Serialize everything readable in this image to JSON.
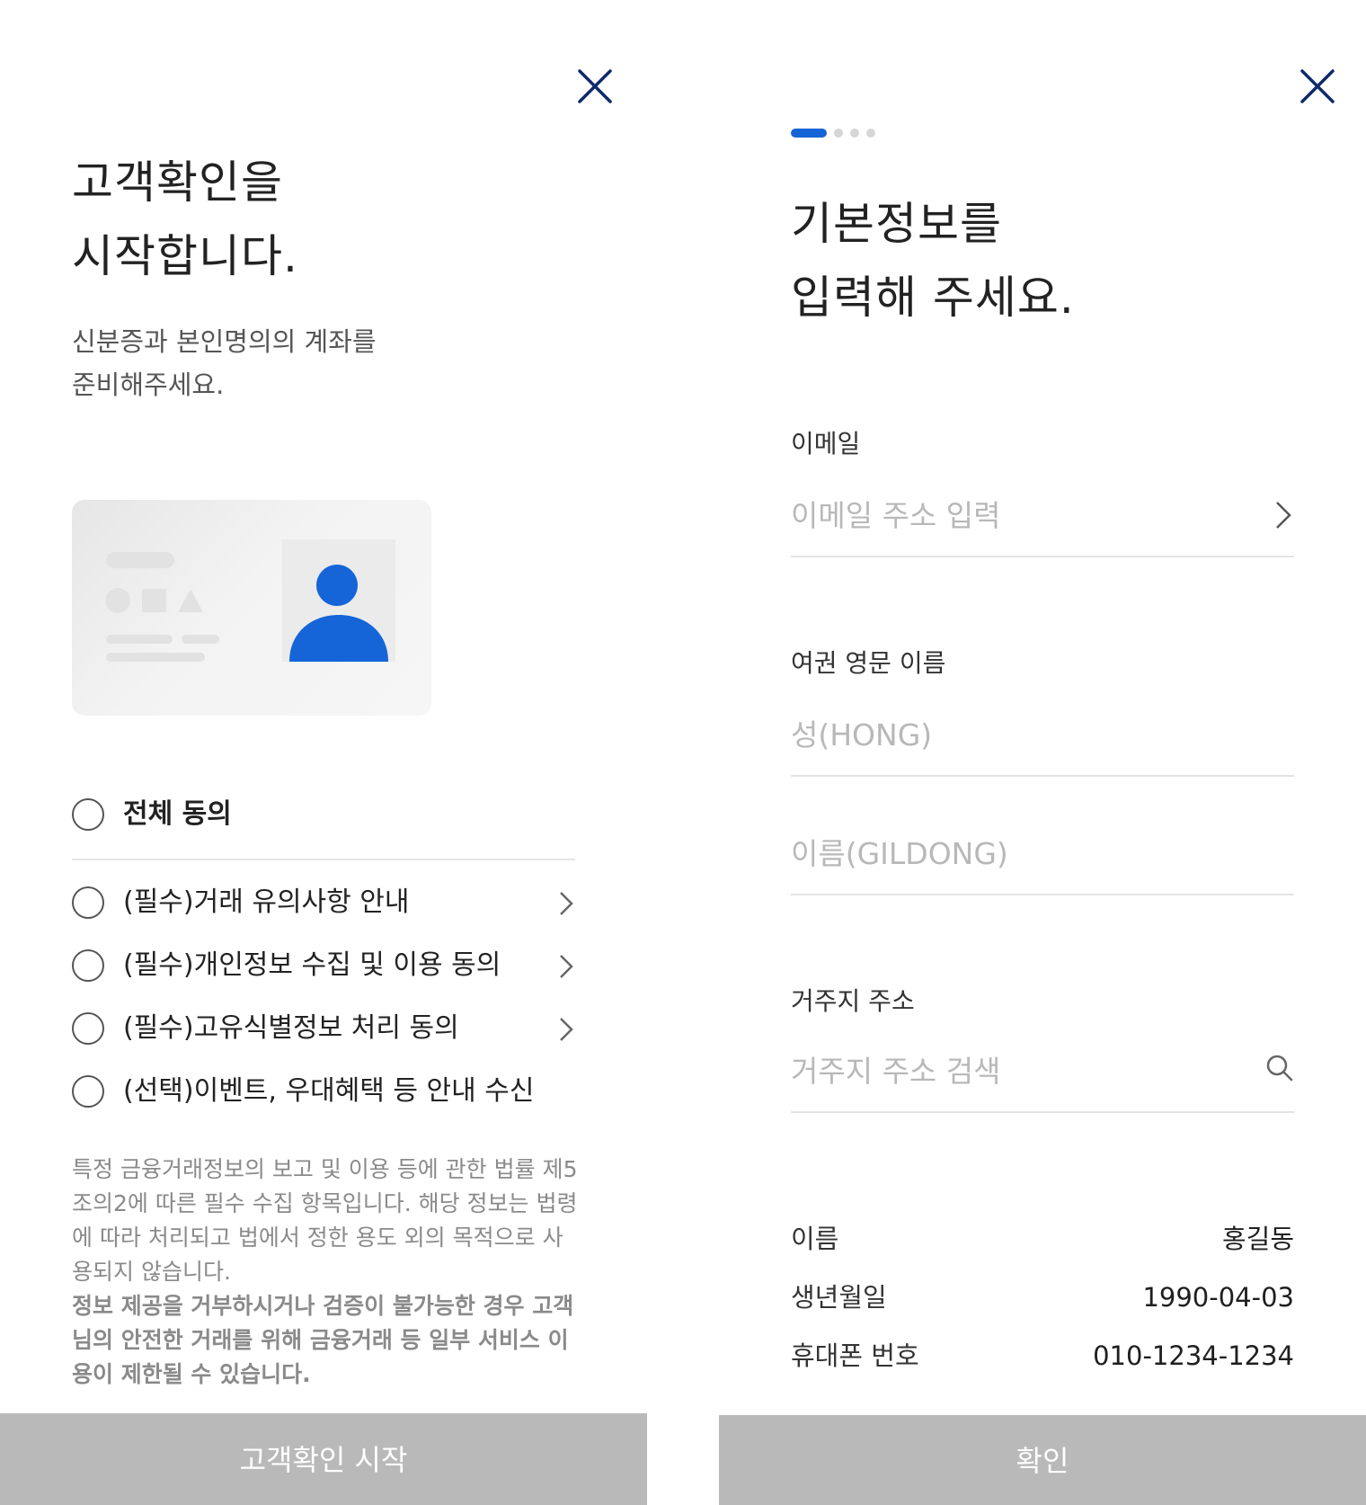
{
  "left": {
    "title_line1": "고객확인을",
    "title_line2": "시작합니다.",
    "subtitle_line1": "신분증과 본인명의의 계좌를",
    "subtitle_line2": "준비해주세요.",
    "agree_all": "전체 동의",
    "agreements": [
      {
        "label": "(필수)거래 유의사항 안내",
        "has_detail": true
      },
      {
        "label": "(필수)개인정보 수집 및 이용 동의",
        "has_detail": true
      },
      {
        "label": "(필수)고유식별정보 처리 동의",
        "has_detail": true
      },
      {
        "label": "(선택)이벤트, 우대혜택 등 안내 수신",
        "has_detail": false
      }
    ],
    "notice_lines": [
      "특정 금융거래정보의 보고 및 이용 등에 관한 법률 제5",
      "조의2에 따른 필수 수집 항목입니다. 해당 정보는 법령",
      "에 따라 처리되고 법에서 정한 용도 외의 목적으로 사",
      "용되지 않습니다."
    ],
    "notice_bold_lines": [
      "정보 제공을 거부하시거나 검증이 불가능한 경우 고객",
      "님의 안전한 거래를 위해 금융거래 등 일부 서비스 이",
      "용이 제한될 수 있습니다."
    ],
    "start_button": "고객확인 시작"
  },
  "right": {
    "step_current": 1,
    "step_total": 4,
    "title_line1": "기본정보를",
    "title_line2": "입력해 주세요.",
    "email_label": "이메일",
    "email_placeholder": "이메일 주소 입력",
    "passport_label": "여권 영문 이름",
    "last_name_placeholder": "성(HONG)",
    "first_name_placeholder": "이름(GILDONG)",
    "address_label": "거주지 주소",
    "address_placeholder": "거주지 주소 검색",
    "info": [
      {
        "label": "이름",
        "value": "홍길동"
      },
      {
        "label": "생년월일",
        "value": "1990-04-03"
      },
      {
        "label": "휴대폰 번호",
        "value": "010-1234-1234"
      }
    ],
    "confirm_button": "확인"
  },
  "icons": {
    "close": "close-icon",
    "chevron": "chevron-right-icon",
    "search": "search-icon",
    "id_card": "id-card-illustration"
  },
  "colors": {
    "accent": "#1565d8",
    "close_icon": "#0d2a6b",
    "button_disabled": "#b9b9b9",
    "placeholder": "#b8b8b8",
    "notice_text": "#8a8a8a"
  }
}
